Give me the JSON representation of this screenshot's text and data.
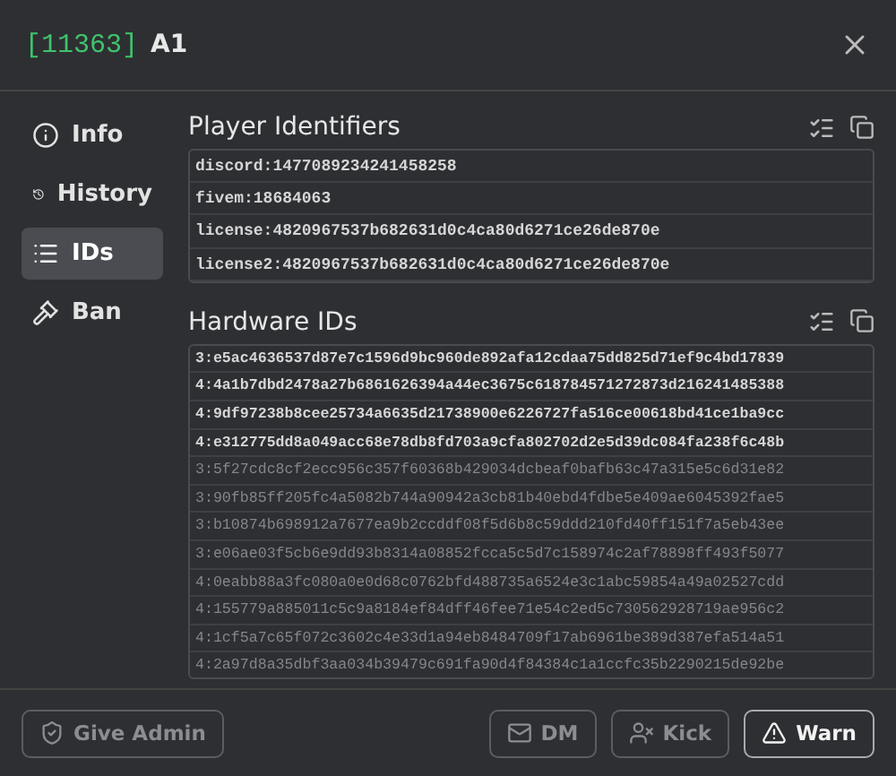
{
  "header": {
    "id": "[11363]",
    "name": "A1"
  },
  "sidebar": {
    "items": [
      {
        "label": "Info",
        "selected": false
      },
      {
        "label": "History",
        "selected": false
      },
      {
        "label": "IDs",
        "selected": true
      },
      {
        "label": "Ban",
        "selected": false
      }
    ]
  },
  "sections": [
    {
      "title": "Player Identifiers",
      "rows": [
        {
          "text": "discord:1477089234241458258",
          "disabled": false
        },
        {
          "text": "fivem:18684063",
          "disabled": false
        },
        {
          "text": "license:4820967537b682631d0c4ca80d6271ce26de870e",
          "disabled": false
        },
        {
          "text": "license2:4820967537b682631d0c4ca80d6271ce26de870e",
          "disabled": false
        }
      ]
    },
    {
      "title": "Hardware IDs",
      "rows": [
        {
          "text": "3:e5ac4636537d87e7c1596d9bc960de892afa12cdaa75dd825d71ef9c4bd17839",
          "disabled": false
        },
        {
          "text": "4:4a1b7dbd2478a27b6861626394a44ec3675c618784571272873d216241485388",
          "disabled": false
        },
        {
          "text": "4:9df97238b8cee25734a6635d21738900e6226727fa516ce00618bd41ce1ba9cc",
          "disabled": false
        },
        {
          "text": "4:e312775dd8a049acc68e78db8fd703a9cfa802702d2e5d39dc084fa238f6c48b",
          "disabled": false
        },
        {
          "text": "3:5f27cdc8cf2ecc956c357f60368b429034dcbeaf0bafb63c47a315e5c6d31e82",
          "disabled": true
        },
        {
          "text": "3:90fb85ff205fc4a5082b744a90942a3cb81b40ebd4fdbe5e409ae6045392fae5",
          "disabled": true
        },
        {
          "text": "3:b10874b698912a7677ea9b2ccddf08f5d6b8c59ddd210fd40ff151f7a5eb43ee",
          "disabled": true
        },
        {
          "text": "3:e06ae03f5cb6e9dd93b8314a08852fcca5c5d7c158974c2af78898ff493f5077",
          "disabled": true
        },
        {
          "text": "4:0eabb88a3fc080a0e0d68c0762bfd488735a6524e3c1abc59854a49a02527cdd",
          "disabled": true
        },
        {
          "text": "4:155779a885011c5c9a8184ef84dff46fee71e54c2ed5c730562928719ae956c2",
          "disabled": true
        },
        {
          "text": "4:1cf5a7c65f072c3602c4e33d1a94eb8484709f17ab6961be389d387efa514a51",
          "disabled": true
        },
        {
          "text": "4:2a97d8a35dbf3aa034b39479c691fa90d4f84384c1a1ccfc35b2290215de92be",
          "disabled": true
        }
      ]
    }
  ],
  "footer": {
    "buttons": [
      {
        "label": "Give Admin",
        "disabled": true
      },
      {
        "label": "DM",
        "disabled": true
      },
      {
        "label": "Kick",
        "disabled": true
      },
      {
        "label": "Warn",
        "disabled": false
      }
    ]
  }
}
